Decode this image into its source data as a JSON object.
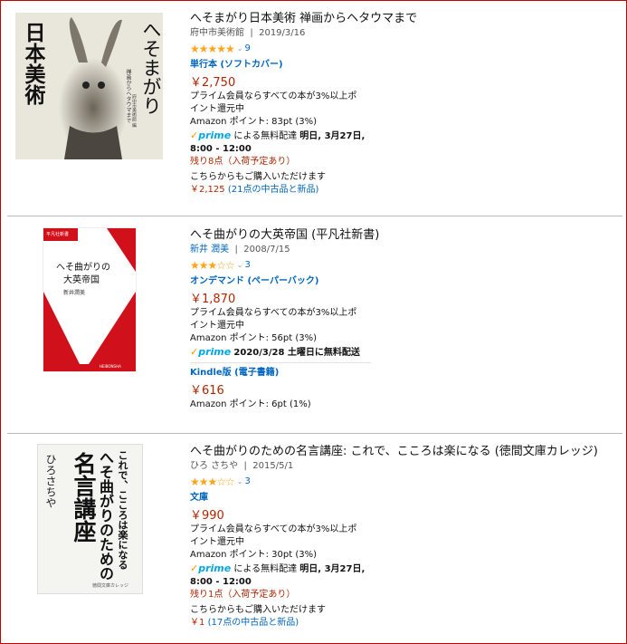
{
  "results": [
    {
      "title": "へそまがり日本美術 禅画からヘタウマまで",
      "author": "府中市美術館",
      "date": "2019/3/16",
      "rating_stars": 5,
      "review_count": "9",
      "format": "単行本 (ソフトカバー)",
      "price": "￥2,750",
      "points_note_1": "プライム会員ならすべての本が3%以上ポ",
      "points_note_2": "イント還元中",
      "amazon_points": "Amazon ポイント: 83pt (3%)",
      "prime_label": "prime",
      "delivery_text": "による無料配達",
      "delivery_date": "明日, 3月27日,",
      "delivery_time": "8:00 - 12:00",
      "stock": "残り8点（入荷予定あり）",
      "other_buy": "こちらからもご購入いただけます",
      "used_price": "￥2,125",
      "used_offers": "(21点の中古品と新品)",
      "cover": {
        "title_main": "へそまがり",
        "title_sub": "日本美術",
        "subtitle": "禅画からヘタウマまで",
        "publisher": "府中市美術館 編"
      }
    },
    {
      "title": "へそ曲がりの大英帝国 (平凡社新書)",
      "author": "新井 潤美",
      "date": "2008/7/15",
      "rating_stars": 3,
      "review_count": "3",
      "format": "オンデマンド (ペーパーバック)",
      "price": "￥1,870",
      "points_note_1": "プライム会員ならすべての本が3%以上ポ",
      "points_note_2": "イント還元中",
      "amazon_points": "Amazon ポイント: 56pt (3%)",
      "prime_label": "prime",
      "delivery_full": "2020/3/28 土曜日に無料配送",
      "format2": "Kindle版 (電子書籍)",
      "price2": "￥616",
      "amazon_points2": "Amazon ポイント: 6pt (1%)",
      "cover": {
        "series": "平凡社新書",
        "title_line1": "へそ曲がりの",
        "title_line2": "大英帝国",
        "author": "新井潤美",
        "footer": "HEIBONSHA"
      }
    },
    {
      "title": "へそ曲がりのための名言講座: これで、こころは楽になる (徳間文庫カレッジ)",
      "author": "ひろ さちや",
      "date": "2015/5/1",
      "rating_stars": 3,
      "review_count": "3",
      "format": "文庫",
      "price": "￥990",
      "points_note_1": "プライム会員ならすべての本が3%以上ポ",
      "points_note_2": "イント還元中",
      "amazon_points": "Amazon ポイント: 30pt (3%)",
      "prime_label": "prime",
      "delivery_text": "による無料配達",
      "delivery_date": "明日, 3月27日,",
      "delivery_time": "8:00 - 12:00",
      "stock": "残り1点（入荷予定あり）",
      "other_buy": "こちらからもご購入いただけます",
      "used_price": "￥1",
      "used_offers": "(17点の中古品と新品)",
      "cover": {
        "col1": "これで、こころは楽になる",
        "col2": "へそ曲がりのための",
        "col3": "名言講座",
        "col4": "ひろさちや",
        "footer": "徳間文庫カレッジ"
      }
    }
  ]
}
